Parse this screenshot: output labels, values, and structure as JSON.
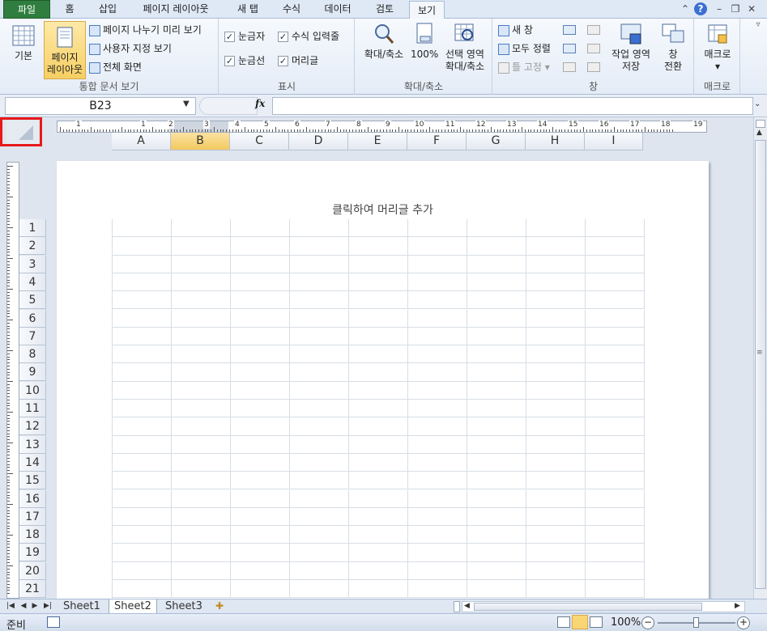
{
  "tabs": [
    {
      "label": "파일",
      "kind": "file"
    },
    {
      "label": "홈"
    },
    {
      "label": "삽입"
    },
    {
      "label": "페이지 레이아웃"
    },
    {
      "label": "새 탭"
    },
    {
      "label": "수식"
    },
    {
      "label": "데이터"
    },
    {
      "label": "검토"
    },
    {
      "label": "보기",
      "kind": "active"
    }
  ],
  "ribbon": {
    "workbook_views": {
      "group_label": "통합 문서 보기",
      "normal": "기본",
      "page_layout_1": "페이지",
      "page_layout_2": "레이아웃",
      "page_break": "페이지 나누기 미리 보기",
      "custom_views": "사용자 지정 보기",
      "full_screen": "전체 화면"
    },
    "show": {
      "group_label": "표시",
      "ruler": "눈금자",
      "formula_bar": "수식 입력줄",
      "gridlines": "눈금선",
      "headings": "머리글"
    },
    "zoom": {
      "group_label": "확대/축소",
      "zoom": "확대/축소",
      "hundred": "100%",
      "zoom_sel_1": "선택 영역",
      "zoom_sel_2": "확대/축소"
    },
    "window": {
      "group_label": "창",
      "new_window": "새 창",
      "arrange_all": "모두 정렬",
      "freeze": "틀 고정",
      "save_ws_1": "작업 영역",
      "save_ws_2": "저장",
      "switch_1": "창",
      "switch_2": "전환"
    },
    "macros": {
      "group_label": "매크로",
      "macros": "매크로"
    }
  },
  "formula_bar": {
    "name_box": "B23",
    "fx": "fx",
    "value": ""
  },
  "columns": [
    "A",
    "B",
    "C",
    "D",
    "E",
    "F",
    "G",
    "H",
    "I"
  ],
  "selected_column": "B",
  "rows": [
    "1",
    "2",
    "3",
    "4",
    "5",
    "6",
    "7",
    "8",
    "9",
    "10",
    "11",
    "12",
    "13",
    "14",
    "15",
    "16",
    "17",
    "18",
    "19",
    "20",
    "21"
  ],
  "ruler_numbers": [
    "1",
    "1",
    "2",
    "3",
    "4",
    "5",
    "6",
    "7",
    "8",
    "9",
    "10",
    "11",
    "12",
    "13",
    "14",
    "15",
    "16",
    "17",
    "18",
    "19"
  ],
  "header_placeholder": "클릭하여 머리글 추가",
  "sheets": [
    "Sheet1",
    "Sheet2",
    "Sheet3"
  ],
  "active_sheet": "Sheet2",
  "status": {
    "ready": "준비",
    "zoom": "100%"
  }
}
